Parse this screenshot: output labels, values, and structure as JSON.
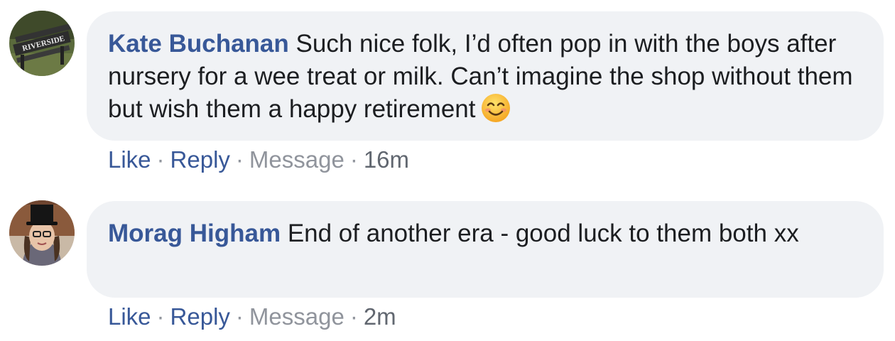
{
  "comments": [
    {
      "author": "Kate Buchanan",
      "text": "Such nice folk, I’d often pop in with the boys after nursery for a wee treat or milk. Can’t imagine the shop without them but wish them a happy retirement",
      "emoji": "smiling-face-with-smiling-eyes",
      "avatar_text": "RIVERSIDE",
      "actions": {
        "like": "Like",
        "reply": "Reply",
        "message": "Message",
        "time": "16m",
        "separator": "·"
      }
    },
    {
      "author": "Morag Higham",
      "text": "End of another era - good luck to them both xx",
      "actions": {
        "like": "Like",
        "reply": "Reply",
        "message": "Message",
        "time": "2m",
        "separator": "·"
      }
    }
  ],
  "colors": {
    "bubble_bg": "#f0f2f5",
    "author": "#385898",
    "link": "#385898",
    "muted": "#90949c"
  }
}
